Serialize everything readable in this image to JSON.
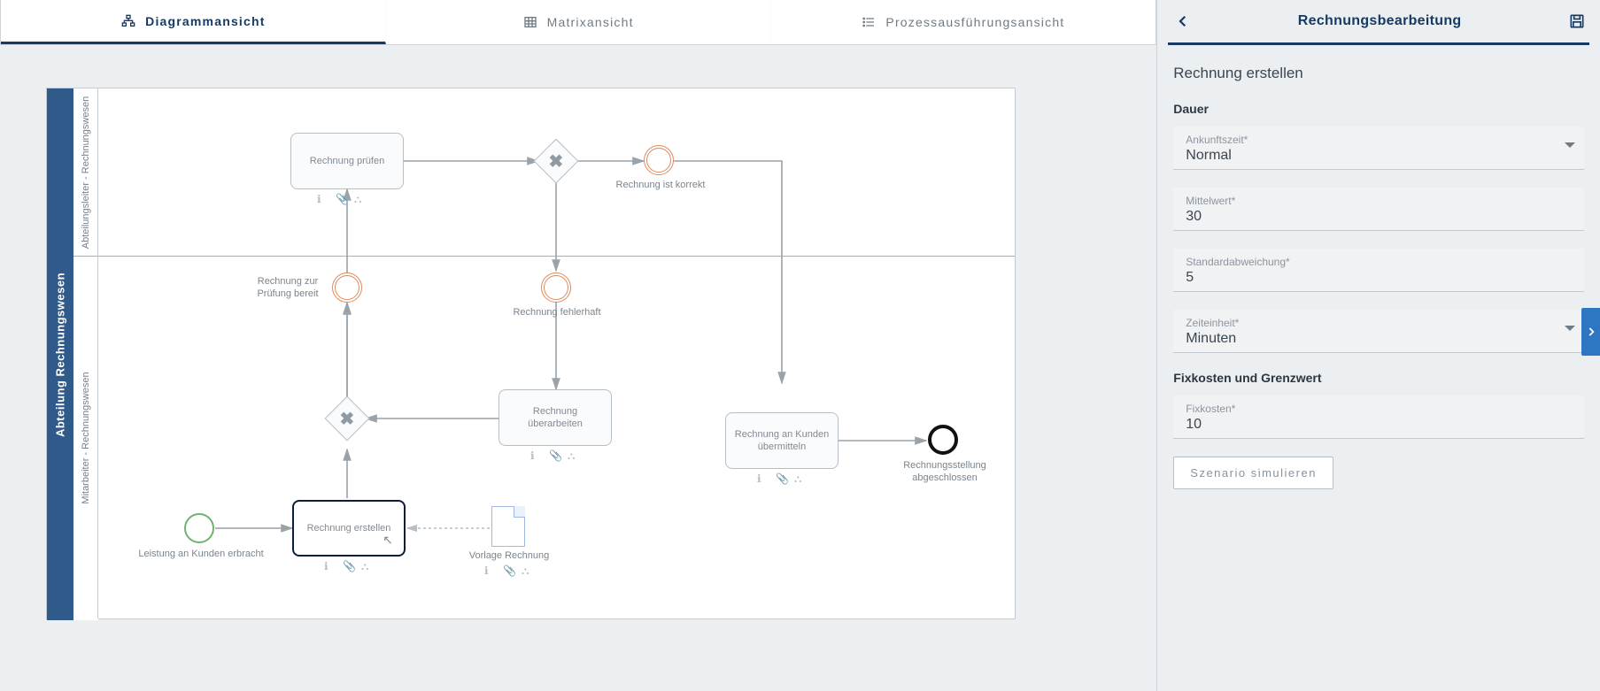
{
  "tabs": {
    "diagram": "Diagrammansicht",
    "matrix": "Matrixansicht",
    "exec": "Prozessausführungsansicht"
  },
  "pool": {
    "name": "Abteilung Rechnungswesen",
    "lanes": {
      "top": "Abteilungsleiter - Rechnungswesen",
      "bottom": "Mitarbeiter - Rechnungswesen"
    }
  },
  "nodes": {
    "start": "Leistung an Kunden erbracht",
    "create": "Rechnung erstellen",
    "doc": "Vorlage Rechnung",
    "ready": "Rechnung zur Prüfung bereit",
    "check": "Rechnung prüfen",
    "ok": "Rechnung ist korrekt",
    "bad": "Rechnung fehlerhaft",
    "rework": "Rechnung überarbeiten",
    "send": "Rechnung an Kunden übermitteln",
    "end": "Rechnungsstellung abgeschlossen"
  },
  "side": {
    "title": "Rechnungsbearbeitung",
    "selected": "Rechnung erstellen",
    "sections": {
      "duration": "Dauer",
      "fixcost": "Fixkosten und Grenzwert"
    },
    "fields": {
      "arrival_label": "Ankunftszeit*",
      "arrival_value": "Normal",
      "mean_label": "Mittelwert*",
      "mean_value": "30",
      "stddev_label": "Standardabweichung*",
      "stddev_value": "5",
      "unit_label": "Zeiteinheit*",
      "unit_value": "Minuten",
      "fixcost_label": "Fixkosten*",
      "fixcost_value": "10"
    },
    "button": "Szenario simulieren"
  }
}
